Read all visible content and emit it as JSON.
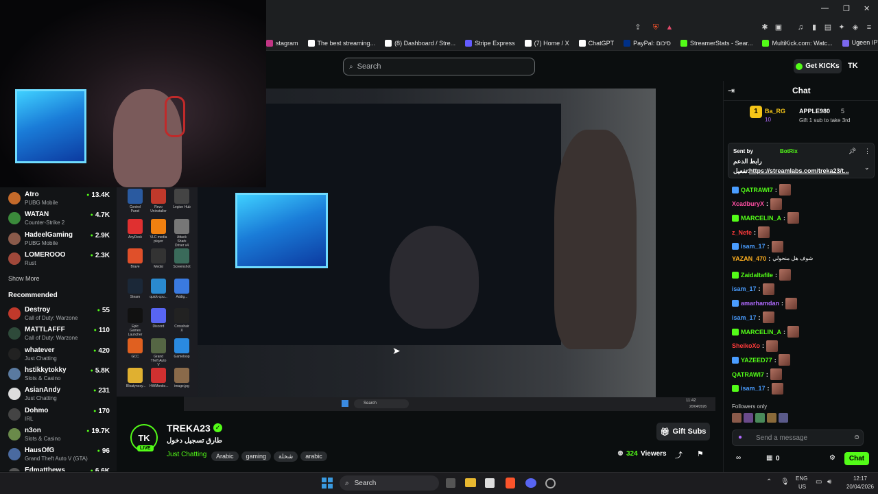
{
  "browser": {
    "bookmarks": [
      {
        "label": "stagram",
        "color": "#c13584"
      },
      {
        "label": "The best streaming...",
        "color": "#ffffff"
      },
      {
        "label": "(8) Dashboard / Stre...",
        "color": "#ffffff"
      },
      {
        "label": "Stripe Express",
        "color": "#635bff"
      },
      {
        "label": "(7) Home / X",
        "color": "#ffffff"
      },
      {
        "label": "ChatGPT",
        "color": "#ffffff"
      },
      {
        "label": "PayPal: סיכום",
        "color": "#003087"
      },
      {
        "label": "StreamerStats - Sear...",
        "color": "#53fc18"
      },
      {
        "label": "MultiKick.com: Watc...",
        "color": "#53fc18"
      },
      {
        "label": "Ugeen IPTV | تسجيل",
        "color": "#7b68ee"
      }
    ]
  },
  "header": {
    "search_placeholder": "Search",
    "get_kicks_label": "Get KICKs",
    "logo_text": "TK"
  },
  "sidebar": {
    "following": [
      {
        "name": "Atro",
        "game": "PUBG Mobile",
        "viewers": "13.4K",
        "color": "#c46a2a"
      },
      {
        "name": "WATAN",
        "game": "Counter-Strike 2",
        "viewers": "4.7K",
        "color": "#3b8a3b"
      },
      {
        "name": "HadeelGaming",
        "game": "PUBG Mobile",
        "viewers": "2.9K",
        "color": "#8a5a4a"
      },
      {
        "name": "LOMEROOO",
        "game": "Rust",
        "viewers": "2.3K",
        "color": "#a0483a"
      }
    ],
    "show_more": "Show More",
    "recommended_title": "Recommended",
    "recommended": [
      {
        "name": "Destroy",
        "game": "Call of Duty: Warzone",
        "viewers": "55",
        "color": "#c0392b"
      },
      {
        "name": "MATTLAFFF",
        "game": "Call of Duty: Warzone",
        "viewers": "110",
        "color": "#2e4a3a"
      },
      {
        "name": "whatever",
        "game": "Just Chatting",
        "viewers": "420",
        "color": "#222222"
      },
      {
        "name": "hstikkytokky",
        "game": "Slots & Casino",
        "viewers": "5.8K",
        "color": "#5a7aa0"
      },
      {
        "name": "AsianAndy",
        "game": "Just Chatting",
        "viewers": "231",
        "color": "#dddddd"
      },
      {
        "name": "Dohmo",
        "game": "IRL",
        "viewers": "170",
        "color": "#444444"
      },
      {
        "name": "n3on",
        "game": "Slots & Casino",
        "viewers": "19.7K",
        "color": "#6a8a4a"
      },
      {
        "name": "HausOfG",
        "game": "Grand Theft Auto V (GTA)",
        "viewers": "96",
        "color": "#4a6aa0"
      },
      {
        "name": "Edmatthews",
        "game": "",
        "viewers": "6.6K",
        "color": "#555555"
      }
    ]
  },
  "desktop": {
    "icons": [
      {
        "label": "Control Panel",
        "color": "#2a5aa0"
      },
      {
        "label": "Revo Uninstaller",
        "color": "#c0392b"
      },
      {
        "label": "Legion Hub",
        "color": "#444444"
      },
      {
        "label": "AnyDesk",
        "color": "#e03030"
      },
      {
        "label": "VLC media player",
        "color": "#f08010"
      },
      {
        "label": "Attack Shark Driver v4",
        "color": "#777777"
      },
      {
        "label": "Brave",
        "color": "#e0502a"
      },
      {
        "label": "Medal",
        "color": "#333333"
      },
      {
        "label": "Screenshot",
        "color": "#3a6a5a"
      },
      {
        "label": "Steam",
        "color": "#1b2838"
      },
      {
        "label": "quick-cpu...",
        "color": "#2a8ad0"
      },
      {
        "label": "Addig...",
        "color": "#3a7ae0"
      },
      {
        "label": "Epic Games Launcher",
        "color": "#111111"
      },
      {
        "label": "Discord",
        "color": "#5865f2"
      },
      {
        "label": "Crosshair X",
        "color": "#222222"
      },
      {
        "label": "GCC",
        "color": "#e06020"
      },
      {
        "label": "Grand Theft Auto V",
        "color": "#556644"
      },
      {
        "label": "Gameloop",
        "color": "#2a8ae0"
      },
      {
        "label": "Bloatynosy...",
        "color": "#e0b030"
      },
      {
        "label": "HWMonito...",
        "color": "#d03030"
      },
      {
        "label": "image.jpg",
        "color": "#8a6a4a"
      }
    ],
    "taskbar_search": "Search",
    "taskbar_time": "11:42",
    "taskbar_date": "20/04/2026"
  },
  "stream": {
    "streamer_name": "TREKA23",
    "live_badge": "LIVE",
    "title": "طارق تسجيل دخول",
    "category": "Just Chatting",
    "tags": [
      "Arabic",
      "gaming",
      "شخلة",
      "arabic"
    ],
    "viewers": "324",
    "viewers_label": "Viewers",
    "gift_subs_label": "Gift Subs"
  },
  "chat": {
    "title": "Chat",
    "leaderboard": {
      "rank": "1",
      "first_user": "Ba_RG",
      "first_count": "10",
      "second_user": "APPLE980",
      "second_count": "5",
      "prompt": "Gift 1 sub to take 3rd"
    },
    "pinned": {
      "sent_by_label": "Sent by",
      "sender": "BotRix",
      "line1": "رابط الدعم",
      "line2_prefix": "تفعيل:",
      "link": "https://streamlabs.com/treka23/t..."
    },
    "messages": [
      {
        "user": "QATRAWI7",
        "color": "#53fc18",
        "text": ""
      },
      {
        "user": "XcadburyX",
        "color": "#ff4fa3",
        "text": ""
      },
      {
        "user": "MARCELIN_A",
        "color": "#53fc18",
        "text": ""
      },
      {
        "user": "z_Nefe",
        "color": "#ff3b3b",
        "text": ""
      },
      {
        "user": "isam_17",
        "color": "#4a9dff",
        "text": ""
      },
      {
        "user": "YAZAN_470",
        "color": "#ffb020",
        "text": "شوف هل منحولي"
      },
      {
        "user": "Zaidaltafile",
        "color": "#53fc18",
        "text": ""
      },
      {
        "user": "isam_17",
        "color": "#4a9dff",
        "text": ""
      },
      {
        "user": "amarhamdan",
        "color": "#b06aff",
        "text": ""
      },
      {
        "user": "isam_17",
        "color": "#4a9dff",
        "text": ""
      },
      {
        "user": "MARCELIN_A",
        "color": "#53fc18",
        "text": ""
      },
      {
        "user": "SheikoXo",
        "color": "#ff3b3b",
        "text": ""
      },
      {
        "user": "YAZEED77",
        "color": "#53fc18",
        "text": ""
      },
      {
        "user": "QATRAWI7",
        "color": "#53fc18",
        "text": ""
      },
      {
        "user": "isam_17",
        "color": "#4a9dff",
        "text": ""
      }
    ],
    "followers_only": "Followers only",
    "input_placeholder": "Send a message",
    "points": "0",
    "send_label": "Chat"
  },
  "taskbar": {
    "search_placeholder": "Search",
    "lang_line1": "ENG",
    "lang_line2": "US",
    "time": "12:17",
    "date": "20/04/2026"
  },
  "colors": {
    "accent": "#53fc18",
    "bg": "#0b0e0f"
  }
}
